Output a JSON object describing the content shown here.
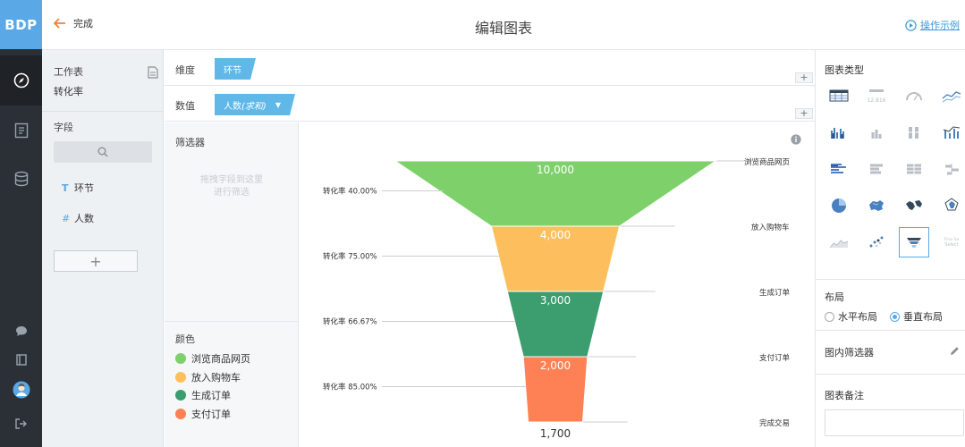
{
  "app": {
    "logo_text": "BDP"
  },
  "header": {
    "back_label": "完成",
    "title": "编辑图表",
    "demo_label": "操作示例"
  },
  "data_panel": {
    "sheet_label": "工作表",
    "sheet_name": "转化率",
    "fields_label": "字段",
    "fields": [
      {
        "type_glyph": "T",
        "name": "环节"
      },
      {
        "type_glyph": "#",
        "name": "人数"
      }
    ],
    "add_label": "+"
  },
  "shelves": {
    "dimension_label": "维度",
    "dimension_pill": "环节",
    "value_label": "数值",
    "value_pill": "人数",
    "value_pill_agg": "(求和)"
  },
  "filter": {
    "label": "筛选器",
    "drop_hint_line1": "拖拽字段到这里",
    "drop_hint_line2": "进行筛选"
  },
  "color_legend": {
    "label": "颜色",
    "items": [
      {
        "name": "浏览商品网页",
        "color": "#7ed06b"
      },
      {
        "name": "放入购物车",
        "color": "#fdbf5e"
      },
      {
        "name": "生成订单",
        "color": "#3c9d6f"
      },
      {
        "name": "支付订单",
        "color": "#fe8155"
      }
    ]
  },
  "chart_data": {
    "type": "funnel",
    "stages": [
      {
        "name": "浏览商品网页",
        "value": 10000,
        "label": "10,000",
        "color": "#7ed06b"
      },
      {
        "name": "放入购物车",
        "value": 4000,
        "label": "4,000",
        "color": "#fdbf5e"
      },
      {
        "name": "生成订单",
        "value": 3000,
        "label": "3,000",
        "color": "#3c9d6f"
      },
      {
        "name": "支付订单",
        "value": 2000,
        "label": "2,000",
        "color": "#fe8155"
      }
    ],
    "final": {
      "name": "完成交易",
      "value": 1700,
      "label": "1,700"
    },
    "conversions": [
      "转化率 40.00%",
      "转化率 75.00%",
      "转化率 66.67%",
      "转化率 85.00%"
    ]
  },
  "right_panel": {
    "chart_type_label": "图表类型",
    "chart_type_icons": [
      "table-icon",
      "kpi-number-icon",
      "gauge-icon",
      "line-chart-icon",
      "column-chart-icon",
      "stacked-column-icon",
      "percent-column-icon",
      "combo-chart-icon",
      "bar-chart-icon",
      "stacked-bar-icon",
      "percent-bar-icon",
      "bidirectional-bar-icon",
      "pie-chart-icon",
      "china-map-icon",
      "world-map-icon",
      "radar-icon",
      "area-chart-icon",
      "scatter-icon",
      "funnel-icon",
      "word-cloud-icon"
    ],
    "kpi_icon_text": "12,816",
    "wordcloud_icon_text": "Fina Sa Select",
    "layout_label": "布局",
    "layout_options": [
      "水平布局",
      "垂直布局"
    ],
    "inner_filter_label": "图内筛选器",
    "note_label": "图表备注"
  }
}
